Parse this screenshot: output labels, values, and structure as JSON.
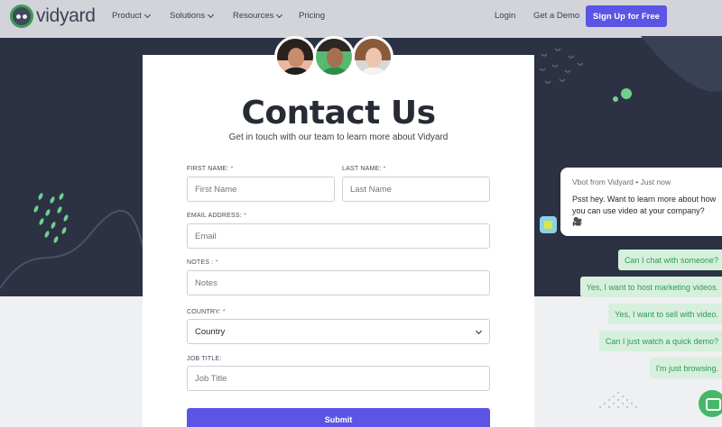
{
  "nav": {
    "logo_text": "vidyard",
    "items": [
      {
        "label": "Product",
        "has_dropdown": true
      },
      {
        "label": "Solutions",
        "has_dropdown": true
      },
      {
        "label": "Resources",
        "has_dropdown": true
      },
      {
        "label": "Pricing",
        "has_dropdown": false
      }
    ],
    "login": "Login",
    "demo": "Get a Demo",
    "signup": "Sign Up for Free"
  },
  "form": {
    "title": "Contact Us",
    "subtitle": "Get in touch with our team to learn more about Vidyard",
    "first_name": {
      "label": "FIRST NAME:",
      "placeholder": "First Name"
    },
    "last_name": {
      "label": "LAST NAME:",
      "placeholder": "Last Name"
    },
    "email": {
      "label": "EMAIL ADDRESS:",
      "placeholder": "Email"
    },
    "notes": {
      "label": "NOTES :",
      "placeholder": "Notes"
    },
    "country": {
      "label": "COUNTRY:",
      "value": "Country"
    },
    "job_title": {
      "label": "JOB TITLE:",
      "placeholder": "Job Title"
    },
    "required_marker": "*",
    "submit": "Submit"
  },
  "chat": {
    "meta": "Vbot from Vidyard • Just now",
    "message": "Psst hey. Want to learn more about how you can use video at your company? 🎥",
    "options": [
      "Can I chat with someone?",
      "Yes, I want to host marketing videos.",
      "Yes, I want to sell with video.",
      "Can I just watch a quick demo?",
      "I'm just browsing."
    ]
  },
  "colors": {
    "brand_purple": "#5b54e5",
    "brand_green": "#45b868",
    "dark_bg": "#2c3244",
    "required_red": "#e0485c"
  }
}
